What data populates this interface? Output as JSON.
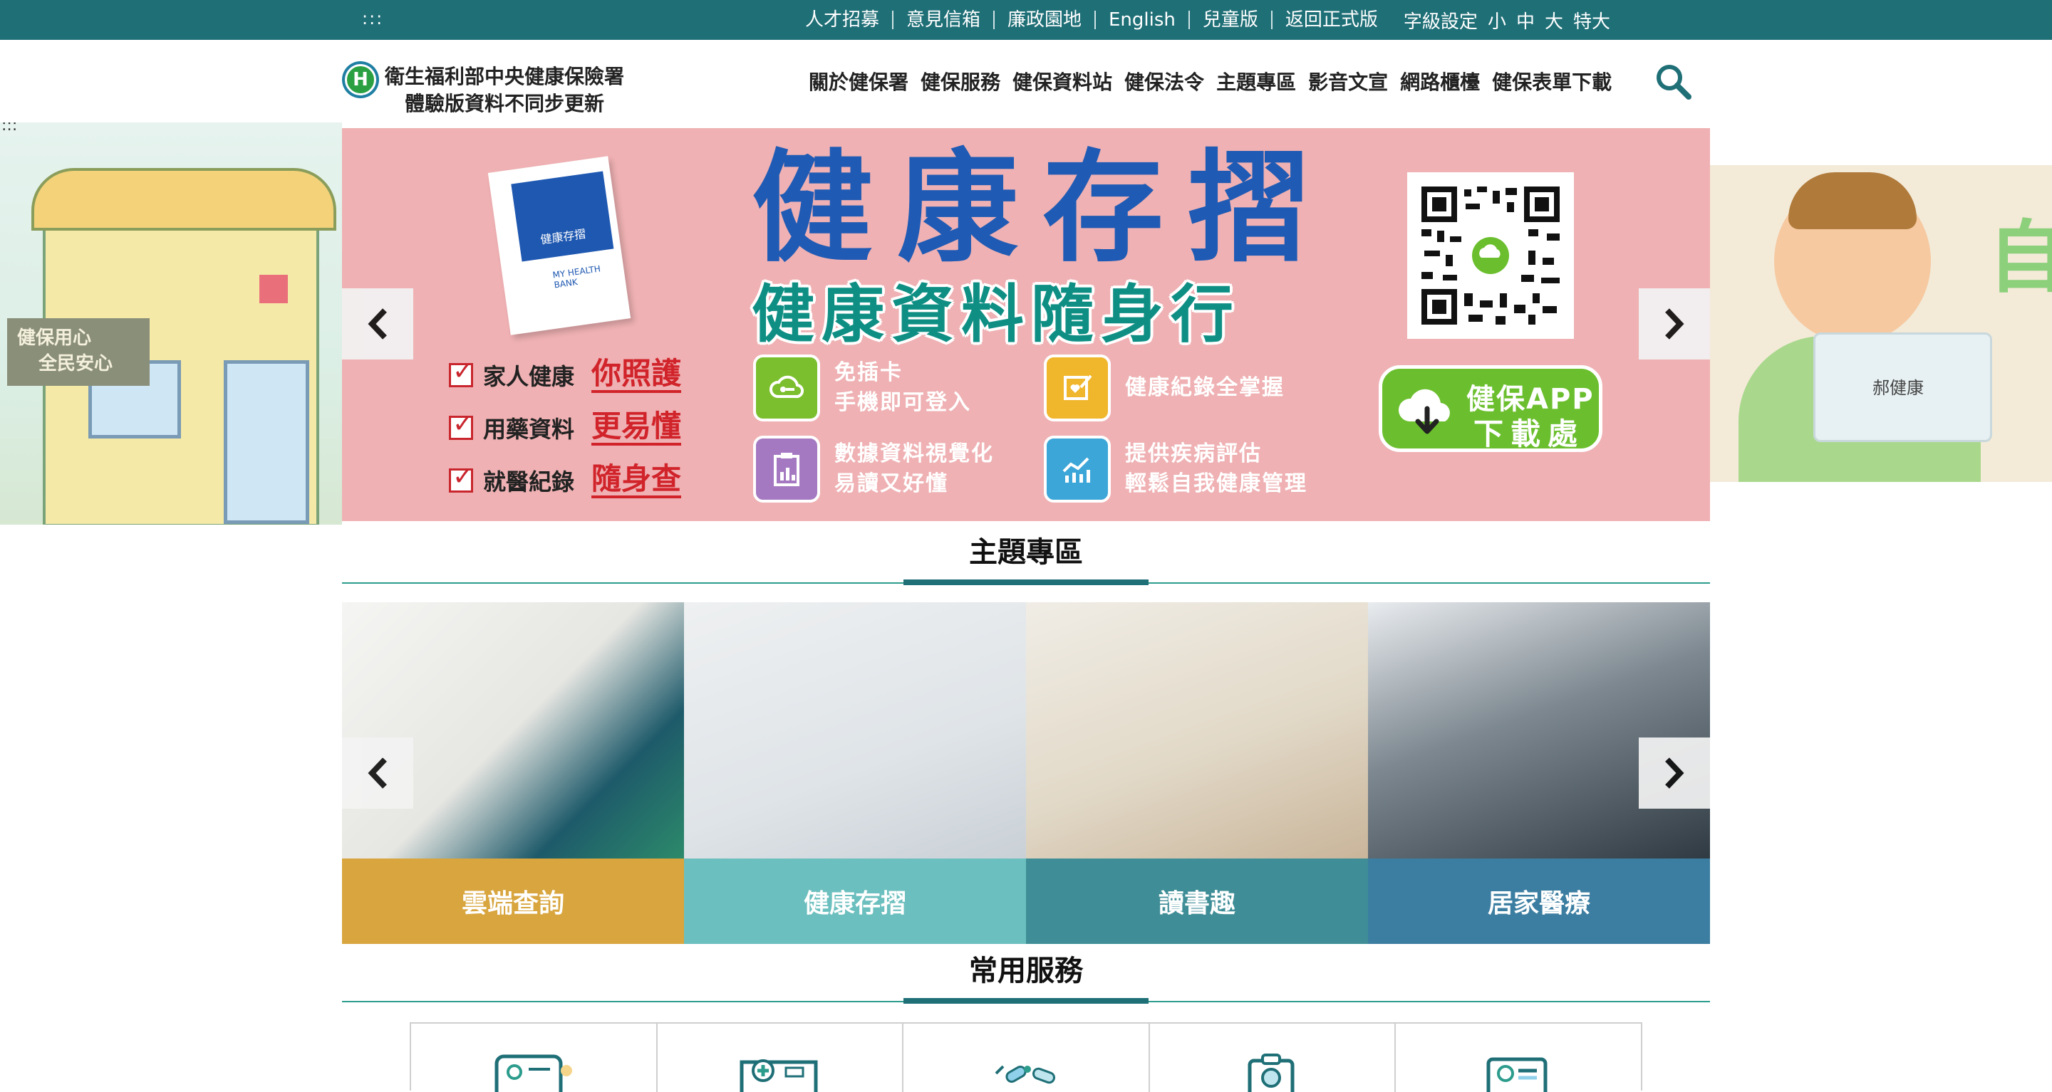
{
  "topbar": {
    "accesskey": ":::",
    "links": [
      "人才招募",
      "意見信箱",
      "廉政園地",
      "English",
      "兒童版",
      "返回正式版"
    ],
    "font_setting_label": "字級設定",
    "font_sizes": [
      "小",
      "中",
      "大",
      "特大"
    ]
  },
  "header": {
    "org_name": "衛生福利部中央健康保險署",
    "org_subtitle": "體驗版資料不同步更新",
    "logo_letter": "H",
    "nav": [
      "關於健保署",
      "健保服務",
      "健保資料站",
      "健保法令",
      "主題專區",
      "影音文宣",
      "網路櫃檯",
      "健保表單下載"
    ],
    "search_icon": "search-icon"
  },
  "side_left": {
    "accesskey": ":::",
    "sign_text": [
      "健保用心",
      "全民安心"
    ]
  },
  "side_right": {
    "card_name": "郝健康",
    "big_char": "自"
  },
  "banner": {
    "book_title": "健康存摺",
    "book_english": "MY HEALTH BANK",
    "headline": "健康存摺",
    "subheadline": "健康資料隨身行",
    "checks": [
      {
        "label": "家人健康",
        "highlight": "你照護"
      },
      {
        "label": "用藥資料",
        "highlight": "更易懂"
      },
      {
        "label": "就醫紀錄",
        "highlight": "隨身查"
      }
    ],
    "features": [
      {
        "line1": "免插卡",
        "line2": "手機即可登入",
        "color": "#7bbf2e",
        "icon": "key-cloud-icon"
      },
      {
        "line1": "健康紀錄全掌握",
        "line2": "",
        "color": "#f0b62c",
        "icon": "heart-edit-icon"
      },
      {
        "line1": "數據資料視覺化",
        "line2": "易讀又好懂",
        "color": "#a479c2",
        "icon": "clipboard-chart-icon"
      },
      {
        "line1": "提供疾病評估",
        "line2": "輕鬆自我健康管理",
        "color": "#3ca6d8",
        "icon": "trend-chart-icon"
      }
    ],
    "download_line1": "健保APP",
    "download_line2": "下載處",
    "prev_icon": "chevron-left-icon",
    "next_icon": "chevron-right-icon"
  },
  "topics": {
    "title": "主題專區",
    "tiles": [
      {
        "label": "雲端查詢",
        "color": "#d8a53e"
      },
      {
        "label": "健康存摺",
        "color": "#6bbfbe"
      },
      {
        "label": "讀書趣",
        "color": "#3f8e97"
      },
      {
        "label": "居家醫療",
        "color": "#3c7ea1"
      }
    ]
  },
  "services": {
    "title": "常用服務",
    "icons": [
      "id-card-icon",
      "hospital-card-icon",
      "medicine-icon",
      "clipboard-doctor-icon",
      "health-card-icon"
    ]
  }
}
